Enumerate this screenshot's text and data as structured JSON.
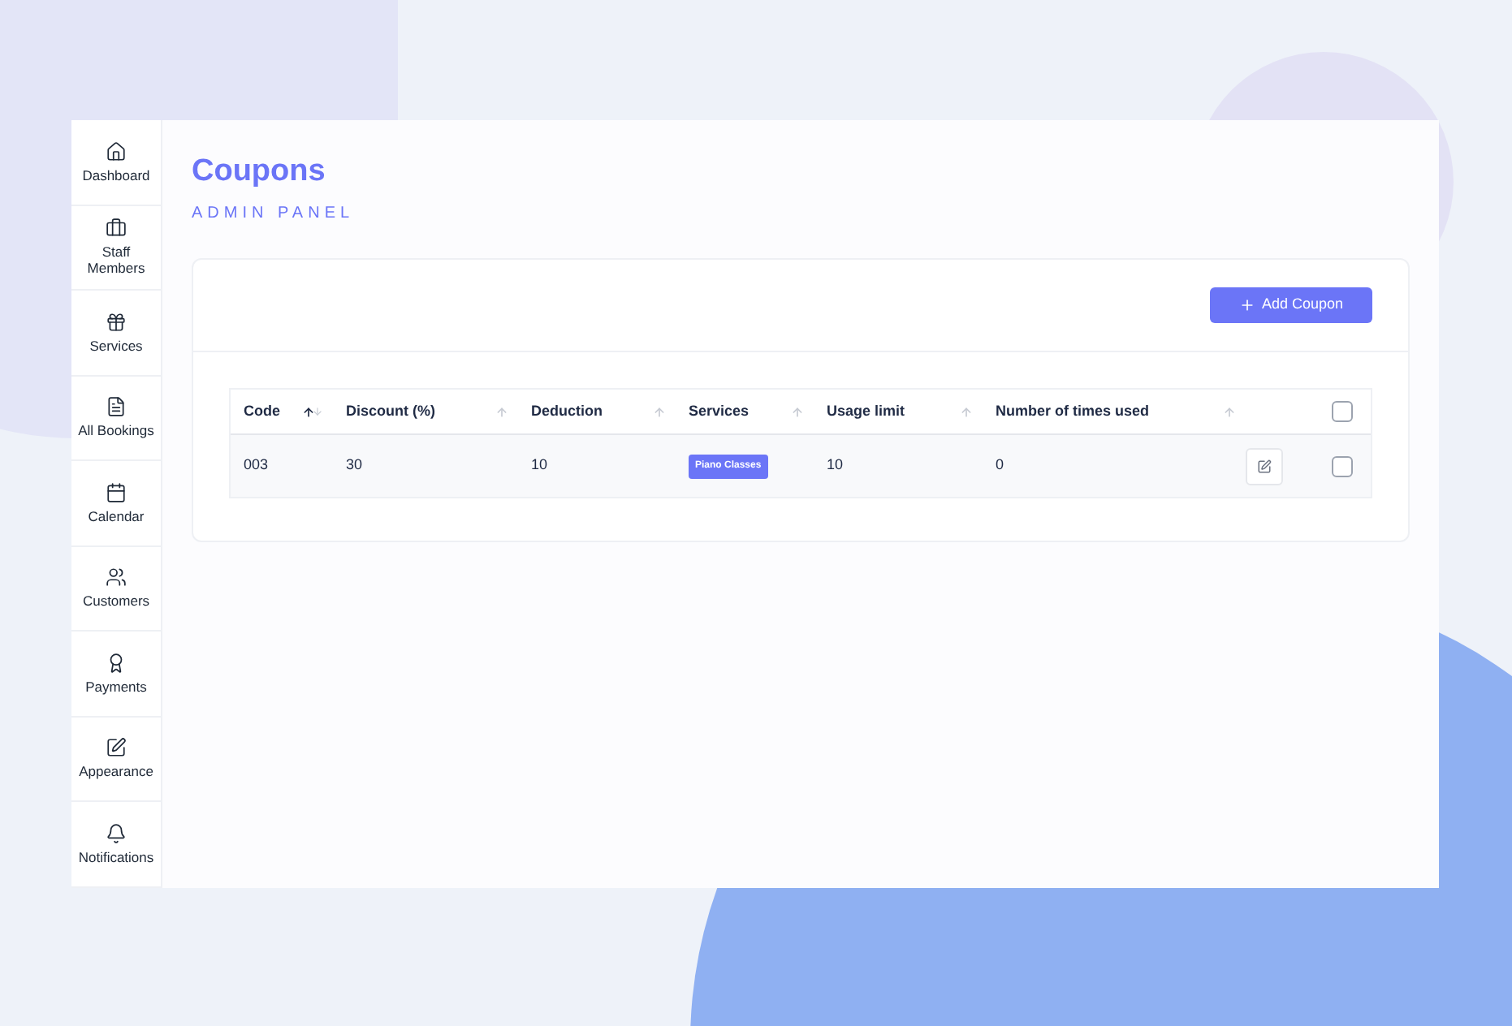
{
  "sidebar": {
    "items": [
      {
        "label": "Dashboard"
      },
      {
        "label": "Staff Members"
      },
      {
        "label": "Services"
      },
      {
        "label": "All Bookings"
      },
      {
        "label": "Calendar"
      },
      {
        "label": "Customers"
      },
      {
        "label": "Payments"
      },
      {
        "label": "Appearance"
      },
      {
        "label": "Notifications"
      }
    ]
  },
  "page": {
    "title": "Coupons",
    "subtitle": "ADMIN PANEL"
  },
  "add_button": "Add Coupon",
  "table": {
    "columns": [
      {
        "label": "Code",
        "sorted": true
      },
      {
        "label": "Discount (%)",
        "sorted": false
      },
      {
        "label": "Deduction",
        "sorted": false
      },
      {
        "label": "Services",
        "sorted": false
      },
      {
        "label": "Usage limit",
        "sorted": false
      },
      {
        "label": "Number of times used",
        "sorted": false
      }
    ],
    "select_all_checked": false,
    "rows": [
      {
        "code": "003",
        "discount": "30",
        "deduction": "10",
        "services": [
          "Piano Classes"
        ],
        "usage_limit": "10",
        "times_used": "0",
        "checked": false
      }
    ]
  }
}
